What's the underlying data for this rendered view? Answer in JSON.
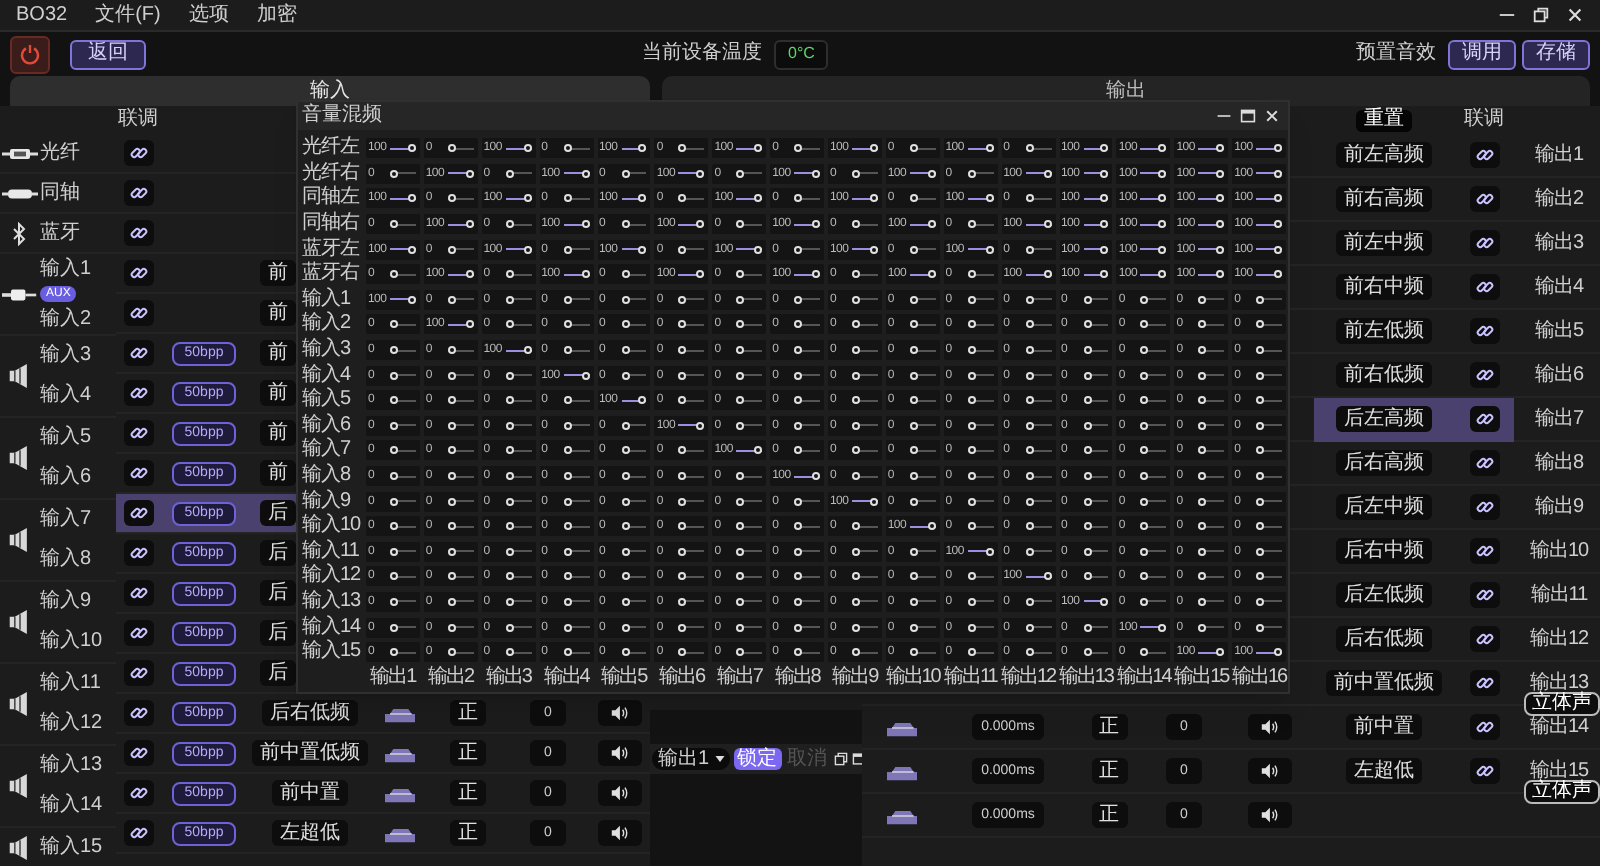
{
  "window": {
    "title": "BO32",
    "menu": [
      "文件(F)",
      "选项",
      "加密"
    ]
  },
  "toolbar": {
    "back_button": "返回",
    "temperature_label": "当前设备温度",
    "temperature": "0°C",
    "preset_label": "预置音效",
    "buttons": [
      "调用",
      "存储"
    ]
  },
  "tabs": [
    {
      "label": "输入",
      "selected": true
    },
    {
      "label": "输出",
      "selected": false
    }
  ],
  "inputs": {
    "header": "联调",
    "sources": [
      {
        "kind": "optical",
        "name": "光纤"
      },
      {
        "kind": "coaxial",
        "name": "同轴"
      },
      {
        "kind": "bluetooth",
        "name": "蓝牙"
      }
    ],
    "groups": [
      {
        "kind": "aux",
        "badge": "AUX",
        "channels": [
          {
            "name": "输入1",
            "selected": false,
            "route": "前"
          },
          {
            "name": "输入2",
            "selected": false,
            "route": "前"
          }
        ]
      },
      {
        "kind": "speaker",
        "channels": [
          {
            "name": "输入3",
            "selected": false,
            "gain": "50bpp",
            "route": "前"
          },
          {
            "name": "输入4",
            "selected": false,
            "gain": "50bpp",
            "route": "前"
          }
        ]
      },
      {
        "kind": "speaker",
        "channels": [
          {
            "name": "输入5",
            "selected": false,
            "gain": "50bpp",
            "route": "前"
          },
          {
            "name": "输入6",
            "selected": false,
            "gain": "50bpp",
            "route": "前"
          }
        ]
      },
      {
        "kind": "speaker",
        "channels": [
          {
            "name": "输入7",
            "selected": true,
            "gain": "50bpp",
            "route": "后"
          },
          {
            "name": "输入8",
            "selected": false,
            "gain": "50bpp",
            "route": "后"
          }
        ]
      },
      {
        "kind": "speaker",
        "channels": [
          {
            "name": "输入9",
            "selected": false,
            "gain": "50bpp",
            "route": "后"
          },
          {
            "name": "输入10",
            "selected": false,
            "gain": "50bpp",
            "route": "后"
          }
        ]
      },
      {
        "kind": "speaker",
        "channels": [
          {
            "name": "输入11",
            "selected": false,
            "gain": "50bpp",
            "route": "后"
          },
          {
            "name": "输入12",
            "selected": false,
            "gain": "50bpp",
            "route": "后右低频",
            "phase": "正",
            "trim": "0"
          }
        ]
      },
      {
        "kind": "speaker",
        "channels": [
          {
            "name": "输入13",
            "selected": false,
            "gain": "50bpp",
            "route": "前中置低频",
            "phase": "正",
            "trim": "0"
          },
          {
            "name": "输入14",
            "selected": false,
            "gain": "50bpp",
            "route": "前中置",
            "phase": "正",
            "trim": "0"
          }
        ]
      },
      {
        "kind": "speaker",
        "channels": [
          {
            "name": "输入15",
            "selected": false,
            "gain": "50bpp",
            "route": "左超低",
            "phase": "正",
            "trim": "0"
          }
        ]
      }
    ]
  },
  "mixer": {
    "title": "音量混频",
    "rows": [
      {
        "label": "光纤左",
        "cells": [
          {
            "value": "100",
            "level": 1
          },
          {
            "value": "0",
            "level": 0
          },
          {
            "value": "100",
            "level": 1
          },
          {
            "value": "0",
            "level": 0
          },
          {
            "value": "100",
            "level": 1
          },
          {
            "value": "0",
            "level": 0
          },
          {
            "value": "100",
            "level": 1
          },
          {
            "value": "0",
            "level": 0
          },
          {
            "value": "100",
            "level": 1
          },
          {
            "value": "0",
            "level": 0
          },
          {
            "value": "100",
            "level": 1
          },
          {
            "value": "0",
            "level": 0
          },
          {
            "value": "100",
            "level": 1
          },
          {
            "value": "100",
            "level": 1
          },
          {
            "value": "100",
            "level": 1
          },
          {
            "value": "100",
            "level": 1
          }
        ]
      },
      {
        "label": "光纤右",
        "cells": [
          {
            "value": "0",
            "level": 0
          },
          {
            "value": "100",
            "level": 1
          },
          {
            "value": "0",
            "level": 0
          },
          {
            "value": "100",
            "level": 1
          },
          {
            "value": "0",
            "level": 0
          },
          {
            "value": "100",
            "level": 1
          },
          {
            "value": "0",
            "level": 0
          },
          {
            "value": "100",
            "level": 1
          },
          {
            "value": "0",
            "level": 0
          },
          {
            "value": "100",
            "level": 1
          },
          {
            "value": "0",
            "level": 0
          },
          {
            "value": "100",
            "level": 1
          },
          {
            "value": "100",
            "level": 1
          },
          {
            "value": "100",
            "level": 1
          },
          {
            "value": "100",
            "level": 1
          },
          {
            "value": "100",
            "level": 1
          }
        ]
      },
      {
        "label": "同轴左",
        "cells": [
          {
            "value": "100",
            "level": 1
          },
          {
            "value": "0",
            "level": 0
          },
          {
            "value": "100",
            "level": 1
          },
          {
            "value": "0",
            "level": 0
          },
          {
            "value": "100",
            "level": 1
          },
          {
            "value": "0",
            "level": 0
          },
          {
            "value": "100",
            "level": 1
          },
          {
            "value": "0",
            "level": 0
          },
          {
            "value": "100",
            "level": 1
          },
          {
            "value": "0",
            "level": 0
          },
          {
            "value": "100",
            "level": 1
          },
          {
            "value": "0",
            "level": 0
          },
          {
            "value": "100",
            "level": 1
          },
          {
            "value": "100",
            "level": 1
          },
          {
            "value": "100",
            "level": 1
          },
          {
            "value": "100",
            "level": 1
          }
        ]
      },
      {
        "label": "同轴右",
        "cells": [
          {
            "value": "0",
            "level": 0
          },
          {
            "value": "100",
            "level": 1
          },
          {
            "value": "0",
            "level": 0
          },
          {
            "value": "100",
            "level": 1
          },
          {
            "value": "0",
            "level": 0
          },
          {
            "value": "100",
            "level": 1
          },
          {
            "value": "0",
            "level": 0
          },
          {
            "value": "100",
            "level": 1
          },
          {
            "value": "0",
            "level": 0
          },
          {
            "value": "100",
            "level": 1
          },
          {
            "value": "0",
            "level": 0
          },
          {
            "value": "100",
            "level": 1
          },
          {
            "value": "100",
            "level": 1
          },
          {
            "value": "100",
            "level": 1
          },
          {
            "value": "100",
            "level": 1
          },
          {
            "value": "100",
            "level": 1
          }
        ]
      },
      {
        "label": "蓝牙左",
        "cells": [
          {
            "value": "100",
            "level": 1
          },
          {
            "value": "0",
            "level": 0
          },
          {
            "value": "100",
            "level": 1
          },
          {
            "value": "0",
            "level": 0
          },
          {
            "value": "100",
            "level": 1
          },
          {
            "value": "0",
            "level": 0
          },
          {
            "value": "100",
            "level": 1
          },
          {
            "value": "0",
            "level": 0
          },
          {
            "value": "100",
            "level": 1
          },
          {
            "value": "0",
            "level": 0
          },
          {
            "value": "100",
            "level": 1
          },
          {
            "value": "0",
            "level": 0
          },
          {
            "value": "100",
            "level": 1
          },
          {
            "value": "100",
            "level": 1
          },
          {
            "value": "100",
            "level": 1
          },
          {
            "value": "100",
            "level": 1
          }
        ]
      },
      {
        "label": "蓝牙右",
        "cells": [
          {
            "value": "0",
            "level": 0
          },
          {
            "value": "100",
            "level": 1
          },
          {
            "value": "0",
            "level": 0
          },
          {
            "value": "100",
            "level": 1
          },
          {
            "value": "0",
            "level": 0
          },
          {
            "value": "100",
            "level": 1
          },
          {
            "value": "0",
            "level": 0
          },
          {
            "value": "100",
            "level": 1
          },
          {
            "value": "0",
            "level": 0
          },
          {
            "value": "100",
            "level": 1
          },
          {
            "value": "0",
            "level": 0
          },
          {
            "value": "100",
            "level": 1
          },
          {
            "value": "100",
            "level": 1
          },
          {
            "value": "100",
            "level": 1
          },
          {
            "value": "100",
            "level": 1
          },
          {
            "value": "100",
            "level": 1
          }
        ]
      },
      {
        "label": "输入1",
        "cells": [
          {
            "value": "100",
            "level": 1
          },
          {
            "value": "0",
            "level": 0
          },
          {
            "value": "0",
            "level": 0
          },
          {
            "value": "0",
            "level": 0
          },
          {
            "value": "0",
            "level": 0
          },
          {
            "value": "0",
            "level": 0
          },
          {
            "value": "0",
            "level": 0
          },
          {
            "value": "0",
            "level": 0
          },
          {
            "value": "0",
            "level": 0
          },
          {
            "value": "0",
            "level": 0
          },
          {
            "value": "0",
            "level": 0
          },
          {
            "value": "0",
            "level": 0
          },
          {
            "value": "0",
            "level": 0
          },
          {
            "value": "0",
            "level": 0
          },
          {
            "value": "0",
            "level": 0
          },
          {
            "value": "0",
            "level": 0
          }
        ]
      },
      {
        "label": "输入2",
        "cells": [
          {
            "value": "0",
            "level": 0
          },
          {
            "value": "100",
            "level": 1
          },
          {
            "value": "0",
            "level": 0
          },
          {
            "value": "0",
            "level": 0
          },
          {
            "value": "0",
            "level": 0
          },
          {
            "value": "0",
            "level": 0
          },
          {
            "value": "0",
            "level": 0
          },
          {
            "value": "0",
            "level": 0
          },
          {
            "value": "0",
            "level": 0
          },
          {
            "value": "0",
            "level": 0
          },
          {
            "value": "0",
            "level": 0
          },
          {
            "value": "0",
            "level": 0
          },
          {
            "value": "0",
            "level": 0
          },
          {
            "value": "0",
            "level": 0
          },
          {
            "value": "0",
            "level": 0
          },
          {
            "value": "0",
            "level": 0
          }
        ]
      },
      {
        "label": "输入3",
        "cells": [
          {
            "value": "0",
            "level": 0
          },
          {
            "value": "0",
            "level": 0
          },
          {
            "value": "100",
            "level": 1
          },
          {
            "value": "0",
            "level": 0
          },
          {
            "value": "0",
            "level": 0
          },
          {
            "value": "0",
            "level": 0
          },
          {
            "value": "0",
            "level": 0
          },
          {
            "value": "0",
            "level": 0
          },
          {
            "value": "0",
            "level": 0
          },
          {
            "value": "0",
            "level": 0
          },
          {
            "value": "0",
            "level": 0
          },
          {
            "value": "0",
            "level": 0
          },
          {
            "value": "0",
            "level": 0
          },
          {
            "value": "0",
            "level": 0
          },
          {
            "value": "0",
            "level": 0
          },
          {
            "value": "0",
            "level": 0
          }
        ]
      },
      {
        "label": "输入4",
        "cells": [
          {
            "value": "0",
            "level": 0
          },
          {
            "value": "0",
            "level": 0
          },
          {
            "value": "0",
            "level": 0
          },
          {
            "value": "100",
            "level": 1
          },
          {
            "value": "0",
            "level": 0
          },
          {
            "value": "0",
            "level": 0
          },
          {
            "value": "0",
            "level": 0
          },
          {
            "value": "0",
            "level": 0
          },
          {
            "value": "0",
            "level": 0
          },
          {
            "value": "0",
            "level": 0
          },
          {
            "value": "0",
            "level": 0
          },
          {
            "value": "0",
            "level": 0
          },
          {
            "value": "0",
            "level": 0
          },
          {
            "value": "0",
            "level": 0
          },
          {
            "value": "0",
            "level": 0
          },
          {
            "value": "0",
            "level": 0
          }
        ]
      },
      {
        "label": "输入5",
        "cells": [
          {
            "value": "0",
            "level": 0
          },
          {
            "value": "0",
            "level": 0
          },
          {
            "value": "0",
            "level": 0
          },
          {
            "value": "0",
            "level": 0
          },
          {
            "value": "100",
            "level": 1
          },
          {
            "value": "0",
            "level": 0
          },
          {
            "value": "0",
            "level": 0
          },
          {
            "value": "0",
            "level": 0
          },
          {
            "value": "0",
            "level": 0
          },
          {
            "value": "0",
            "level": 0
          },
          {
            "value": "0",
            "level": 0
          },
          {
            "value": "0",
            "level": 0
          },
          {
            "value": "0",
            "level": 0
          },
          {
            "value": "0",
            "level": 0
          },
          {
            "value": "0",
            "level": 0
          },
          {
            "value": "0",
            "level": 0
          }
        ]
      },
      {
        "label": "输入6",
        "cells": [
          {
            "value": "0",
            "level": 0
          },
          {
            "value": "0",
            "level": 0
          },
          {
            "value": "0",
            "level": 0
          },
          {
            "value": "0",
            "level": 0
          },
          {
            "value": "0",
            "level": 0
          },
          {
            "value": "100",
            "level": 1
          },
          {
            "value": "0",
            "level": 0
          },
          {
            "value": "0",
            "level": 0
          },
          {
            "value": "0",
            "level": 0
          },
          {
            "value": "0",
            "level": 0
          },
          {
            "value": "0",
            "level": 0
          },
          {
            "value": "0",
            "level": 0
          },
          {
            "value": "0",
            "level": 0
          },
          {
            "value": "0",
            "level": 0
          },
          {
            "value": "0",
            "level": 0
          },
          {
            "value": "0",
            "level": 0
          }
        ]
      },
      {
        "label": "输入7",
        "cells": [
          {
            "value": "0",
            "level": 0
          },
          {
            "value": "0",
            "level": 0
          },
          {
            "value": "0",
            "level": 0
          },
          {
            "value": "0",
            "level": 0
          },
          {
            "value": "0",
            "level": 0
          },
          {
            "value": "0",
            "level": 0
          },
          {
            "value": "100",
            "level": 1
          },
          {
            "value": "0",
            "level": 0
          },
          {
            "value": "0",
            "level": 0
          },
          {
            "value": "0",
            "level": 0
          },
          {
            "value": "0",
            "level": 0
          },
          {
            "value": "0",
            "level": 0
          },
          {
            "value": "0",
            "level": 0
          },
          {
            "value": "0",
            "level": 0
          },
          {
            "value": "0",
            "level": 0
          },
          {
            "value": "0",
            "level": 0
          }
        ]
      },
      {
        "label": "输入8",
        "cells": [
          {
            "value": "0",
            "level": 0
          },
          {
            "value": "0",
            "level": 0
          },
          {
            "value": "0",
            "level": 0
          },
          {
            "value": "0",
            "level": 0
          },
          {
            "value": "0",
            "level": 0
          },
          {
            "value": "0",
            "level": 0
          },
          {
            "value": "0",
            "level": 0
          },
          {
            "value": "100",
            "level": 1
          },
          {
            "value": "0",
            "level": 0
          },
          {
            "value": "0",
            "level": 0
          },
          {
            "value": "0",
            "level": 0
          },
          {
            "value": "0",
            "level": 0
          },
          {
            "value": "0",
            "level": 0
          },
          {
            "value": "0",
            "level": 0
          },
          {
            "value": "0",
            "level": 0
          },
          {
            "value": "0",
            "level": 0
          }
        ]
      },
      {
        "label": "输入9",
        "cells": [
          {
            "value": "0",
            "level": 0
          },
          {
            "value": "0",
            "level": 0
          },
          {
            "value": "0",
            "level": 0
          },
          {
            "value": "0",
            "level": 0
          },
          {
            "value": "0",
            "level": 0
          },
          {
            "value": "0",
            "level": 0
          },
          {
            "value": "0",
            "level": 0
          },
          {
            "value": "0",
            "level": 0
          },
          {
            "value": "100",
            "level": 1
          },
          {
            "value": "0",
            "level": 0
          },
          {
            "value": "0",
            "level": 0
          },
          {
            "value": "0",
            "level": 0
          },
          {
            "value": "0",
            "level": 0
          },
          {
            "value": "0",
            "level": 0
          },
          {
            "value": "0",
            "level": 0
          },
          {
            "value": "0",
            "level": 0
          }
        ]
      },
      {
        "label": "输入10",
        "cells": [
          {
            "value": "0",
            "level": 0
          },
          {
            "value": "0",
            "level": 0
          },
          {
            "value": "0",
            "level": 0
          },
          {
            "value": "0",
            "level": 0
          },
          {
            "value": "0",
            "level": 0
          },
          {
            "value": "0",
            "level": 0
          },
          {
            "value": "0",
            "level": 0
          },
          {
            "value": "0",
            "level": 0
          },
          {
            "value": "0",
            "level": 0
          },
          {
            "value": "100",
            "level": 1
          },
          {
            "value": "0",
            "level": 0
          },
          {
            "value": "0",
            "level": 0
          },
          {
            "value": "0",
            "level": 0
          },
          {
            "value": "0",
            "level": 0
          },
          {
            "value": "0",
            "level": 0
          },
          {
            "value": "0",
            "level": 0
          }
        ]
      },
      {
        "label": "输入11",
        "cells": [
          {
            "value": "0",
            "level": 0
          },
          {
            "value": "0",
            "level": 0
          },
          {
            "value": "0",
            "level": 0
          },
          {
            "value": "0",
            "level": 0
          },
          {
            "value": "0",
            "level": 0
          },
          {
            "value": "0",
            "level": 0
          },
          {
            "value": "0",
            "level": 0
          },
          {
            "value": "0",
            "level": 0
          },
          {
            "value": "0",
            "level": 0
          },
          {
            "value": "0",
            "level": 0
          },
          {
            "value": "100",
            "level": 1
          },
          {
            "value": "0",
            "level": 0
          },
          {
            "value": "0",
            "level": 0
          },
          {
            "value": "0",
            "level": 0
          },
          {
            "value": "0",
            "level": 0
          },
          {
            "value": "0",
            "level": 0
          }
        ]
      },
      {
        "label": "输入12",
        "cells": [
          {
            "value": "0",
            "level": 0
          },
          {
            "value": "0",
            "level": 0
          },
          {
            "value": "0",
            "level": 0
          },
          {
            "value": "0",
            "level": 0
          },
          {
            "value": "0",
            "level": 0
          },
          {
            "value": "0",
            "level": 0
          },
          {
            "value": "0",
            "level": 0
          },
          {
            "value": "0",
            "level": 0
          },
          {
            "value": "0",
            "level": 0
          },
          {
            "value": "0",
            "level": 0
          },
          {
            "value": "0",
            "level": 0
          },
          {
            "value": "100",
            "level": 1
          },
          {
            "value": "0",
            "level": 0
          },
          {
            "value": "0",
            "level": 0
          },
          {
            "value": "0",
            "level": 0
          },
          {
            "value": "0",
            "level": 0
          }
        ]
      },
      {
        "label": "输入13",
        "cells": [
          {
            "value": "0",
            "level": 0
          },
          {
            "value": "0",
            "level": 0
          },
          {
            "value": "0",
            "level": 0
          },
          {
            "value": "0",
            "level": 0
          },
          {
            "value": "0",
            "level": 0
          },
          {
            "value": "0",
            "level": 0
          },
          {
            "value": "0",
            "level": 0
          },
          {
            "value": "0",
            "level": 0
          },
          {
            "value": "0",
            "level": 0
          },
          {
            "value": "0",
            "level": 0
          },
          {
            "value": "0",
            "level": 0
          },
          {
            "value": "0",
            "level": 0
          },
          {
            "value": "100",
            "level": 1
          },
          {
            "value": "0",
            "level": 0
          },
          {
            "value": "0",
            "level": 0
          },
          {
            "value": "0",
            "level": 0
          }
        ]
      },
      {
        "label": "输入14",
        "cells": [
          {
            "value": "0",
            "level": 0
          },
          {
            "value": "0",
            "level": 0
          },
          {
            "value": "0",
            "level": 0
          },
          {
            "value": "0",
            "level": 0
          },
          {
            "value": "0",
            "level": 0
          },
          {
            "value": "0",
            "level": 0
          },
          {
            "value": "0",
            "level": 0
          },
          {
            "value": "0",
            "level": 0
          },
          {
            "value": "0",
            "level": 0
          },
          {
            "value": "0",
            "level": 0
          },
          {
            "value": "0",
            "level": 0
          },
          {
            "value": "0",
            "level": 0
          },
          {
            "value": "0",
            "level": 0
          },
          {
            "value": "100",
            "level": 1
          },
          {
            "value": "0",
            "level": 0
          },
          {
            "value": "0",
            "level": 0
          }
        ]
      },
      {
        "label": "输入15",
        "cells": [
          {
            "value": "0",
            "level": 0
          },
          {
            "value": "0",
            "level": 0
          },
          {
            "value": "0",
            "level": 0
          },
          {
            "value": "0",
            "level": 0
          },
          {
            "value": "0",
            "level": 0
          },
          {
            "value": "0",
            "level": 0
          },
          {
            "value": "0",
            "level": 0
          },
          {
            "value": "0",
            "level": 0
          },
          {
            "value": "0",
            "level": 0
          },
          {
            "value": "0",
            "level": 0
          },
          {
            "value": "0",
            "level": 0
          },
          {
            "value": "0",
            "level": 0
          },
          {
            "value": "0",
            "level": 0
          },
          {
            "value": "0",
            "level": 0
          },
          {
            "value": "100",
            "level": 1
          },
          {
            "value": "100",
            "level": 1
          }
        ]
      }
    ],
    "footer_labels": [
      "输出1",
      "输出2",
      "输出3",
      "输出4",
      "输出5",
      "输出6",
      "输出7",
      "输出8",
      "输出9",
      "输出10",
      "输出11",
      "输出12",
      "输出13",
      "输出14",
      "输出15",
      "输出16"
    ]
  },
  "output_panel": {
    "channel_select": "输出1",
    "lock_button": "锁定",
    "cancel_button": {
      "label": "取消",
      "disabled": true
    }
  },
  "outputs": {
    "reset_button": "重置",
    "header": "联调",
    "channels": [
      {
        "name": "输出1",
        "route": "前左高频",
        "selected": false
      },
      {
        "name": "输出2",
        "route": "前右高频",
        "selected": false
      },
      {
        "name": "输出3",
        "route": "前左中频",
        "selected": false
      },
      {
        "name": "输出4",
        "route": "前右中频",
        "selected": false
      },
      {
        "name": "输出5",
        "route": "前左低频",
        "selected": false
      },
      {
        "name": "输出6",
        "route": "前右低频",
        "selected": false
      },
      {
        "name": "输出7",
        "route": "后左高频",
        "selected": true
      },
      {
        "name": "输出8",
        "route": "后右高频",
        "selected": false
      },
      {
        "name": "输出9",
        "route": "后左中频",
        "selected": false
      },
      {
        "name": "输出10",
        "route": "后右中频",
        "selected": false
      },
      {
        "name": "输出11",
        "route": "后左低频",
        "selected": false
      },
      {
        "name": "输出12",
        "route": "后右低频",
        "selected": false
      },
      {
        "name": "输出13",
        "route": "前中置低频",
        "selected": false,
        "stereo": "立体声"
      },
      {
        "name": "输出14",
        "route": "前中置",
        "selected": false,
        "delay": "0.000ms",
        "phase": "正",
        "trim": "0"
      },
      {
        "name": "输出15",
        "route": "左超低",
        "selected": false,
        "delay": "0.000ms",
        "phase": "正",
        "trim": "0",
        "stereo": "立体声"
      },
      {
        "delay": "0.000ms",
        "phase": "正",
        "trim": "0"
      }
    ]
  }
}
